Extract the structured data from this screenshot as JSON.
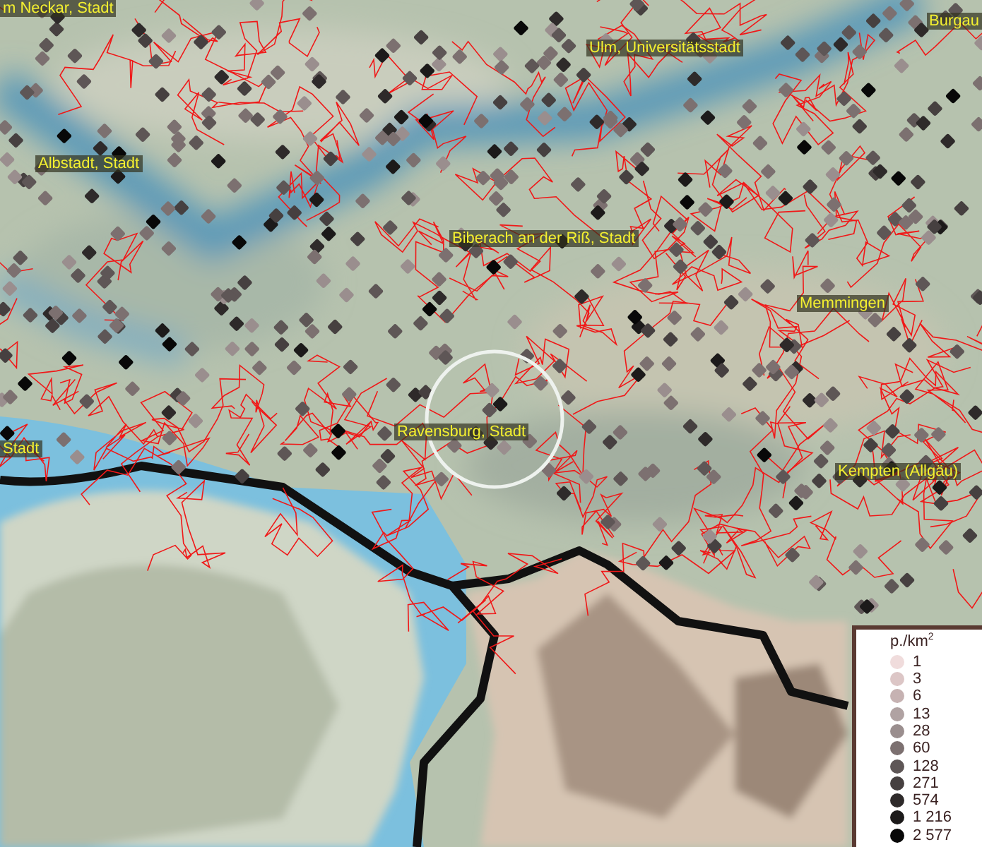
{
  "map": {
    "labels": [
      {
        "text": "m Neckar, Stadt"
      },
      {
        "text": "Ulm, Universitätsstadt"
      },
      {
        "text": "Burgau"
      },
      {
        "text": "Albstadt, Stadt"
      },
      {
        "text": "Biberach an der Riß, Stadt"
      },
      {
        "text": "Memmingen"
      },
      {
        "text": "Ravensburg, Stadt"
      },
      {
        "text": "Stadt"
      },
      {
        "text": "Kempten (Allgäu)"
      }
    ]
  },
  "legend": {
    "title": "p./km$^{2}$",
    "items": [
      {
        "value": "1",
        "color": "#f0dcdc"
      },
      {
        "value": "3",
        "color": "#dcc6c6"
      },
      {
        "value": "6",
        "color": "#c6b2b2"
      },
      {
        "value": "13",
        "color": "#b0a2a2"
      },
      {
        "value": "28",
        "color": "#9a8e8e"
      },
      {
        "value": "60",
        "color": "#7c7070"
      },
      {
        "value": "128",
        "color": "#5e5656"
      },
      {
        "value": "271",
        "color": "#464040"
      },
      {
        "value": "574",
        "color": "#2e2a2a"
      },
      {
        "value": "1 216",
        "color": "#1c1a1a"
      },
      {
        "value": "2 577",
        "color": "#080808"
      }
    ]
  }
}
